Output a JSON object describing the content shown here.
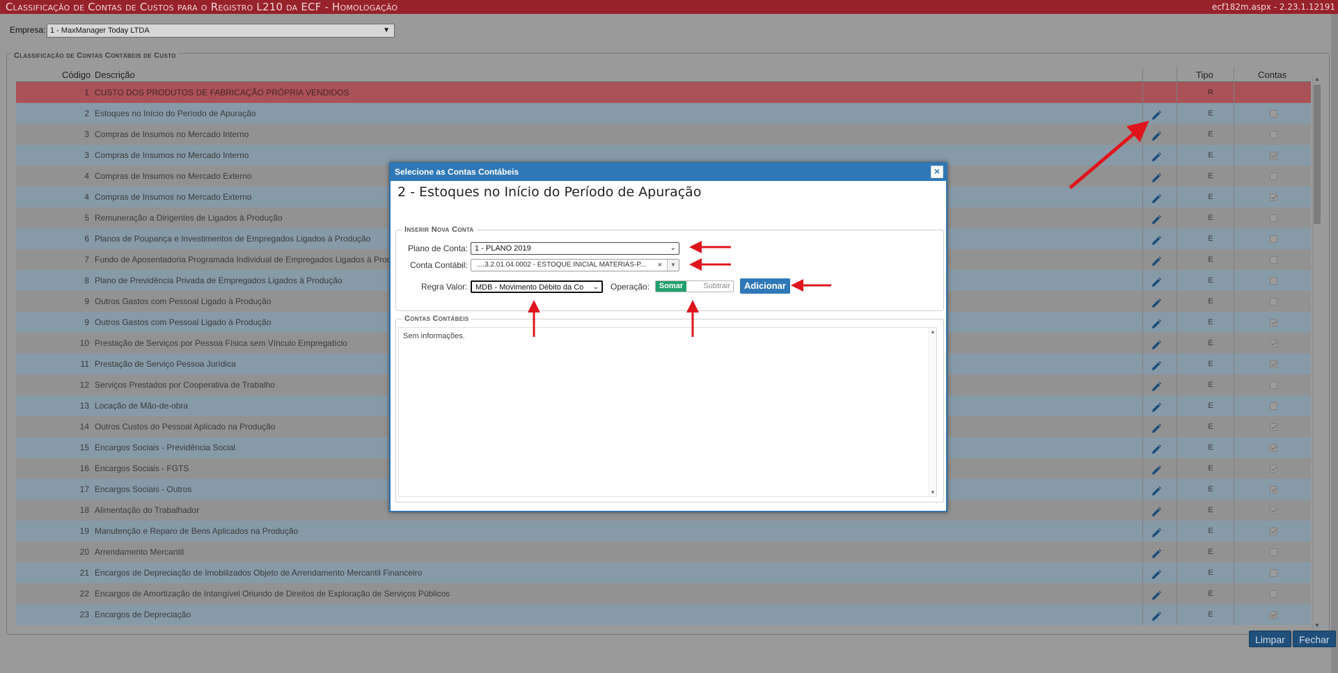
{
  "window": {
    "title": "Classificação de Contas de Custos para o Registro L210 da ECF  - Homologação",
    "version": "ecf182m.aspx - 2.23.1.12191"
  },
  "empresa": {
    "label": "Empresa:",
    "value": "1 - MaxManager Today LTDA"
  },
  "section_legend": "Classificação de Contas Contábeis de Custo",
  "table": {
    "headers": {
      "codigo": "Código",
      "descricao": "Descrição",
      "tipo": "Tipo",
      "contas": "Contas"
    },
    "rows": [
      {
        "codigo": "1",
        "descricao": "CUSTO DOS PRODUTOS DE FABRICAÇÃO PRÓPRIA VENDIDOS",
        "tipo": "R",
        "edit": false,
        "checked": false,
        "check": false
      },
      {
        "codigo": "2",
        "descricao": "Estoques no Início do Período de Apuração",
        "tipo": "E",
        "edit": true,
        "checked": false,
        "check": true
      },
      {
        "codigo": "3",
        "descricao": "Compras de Insumos no Mercado Interno",
        "tipo": "E",
        "edit": true,
        "checked": false,
        "check": true
      },
      {
        "codigo": "3",
        "descricao": "Compras de Insumos no Mercado Interno",
        "tipo": "E",
        "edit": true,
        "checked": true,
        "check": true
      },
      {
        "codigo": "4",
        "descricao": "Compras de Insumos no Mercado Externo",
        "tipo": "E",
        "edit": true,
        "checked": false,
        "check": true
      },
      {
        "codigo": "4",
        "descricao": "Compras de Insumos no Mercado Externo",
        "tipo": "E",
        "edit": true,
        "checked": true,
        "check": true
      },
      {
        "codigo": "5",
        "descricao": "Remuneração a Dirigentes de Ligados à Produção",
        "tipo": "E",
        "edit": true,
        "checked": false,
        "check": true
      },
      {
        "codigo": "6",
        "descricao": "Planos de Poupança e Investimentos de Empregados Ligados à Produção",
        "tipo": "E",
        "edit": true,
        "checked": false,
        "check": true
      },
      {
        "codigo": "7",
        "descricao": "Fundo de Aposentadoria Programada Individual de Empregados Ligados à Prod",
        "tipo": "E",
        "edit": true,
        "checked": false,
        "check": true
      },
      {
        "codigo": "8",
        "descricao": "Plano de Previdência Privada de Empregados Ligados à Produção",
        "tipo": "E",
        "edit": true,
        "checked": false,
        "check": true
      },
      {
        "codigo": "9",
        "descricao": "Outros Gastos com Pessoal Ligado à Produção",
        "tipo": "E",
        "edit": true,
        "checked": false,
        "check": true
      },
      {
        "codigo": "9",
        "descricao": "Outros Gastos com Pessoal Ligado à Produção",
        "tipo": "E",
        "edit": true,
        "checked": true,
        "check": true
      },
      {
        "codigo": "10",
        "descricao": "Prestação de Serviços por Pessoa Física sem Vínculo Empregatício",
        "tipo": "E",
        "edit": true,
        "checked": true,
        "check": true
      },
      {
        "codigo": "11",
        "descricao": "Prestação de Serviço Pessoa Jurídica",
        "tipo": "E",
        "edit": true,
        "checked": true,
        "check": true
      },
      {
        "codigo": "12",
        "descricao": "Serviços Prestados por Cooperativa de Trabalho",
        "tipo": "E",
        "edit": true,
        "checked": false,
        "check": true
      },
      {
        "codigo": "13",
        "descricao": "Locação de Mão-de-obra",
        "tipo": "E",
        "edit": true,
        "checked": false,
        "check": true
      },
      {
        "codigo": "14",
        "descricao": "Outros Custos do Pessoal Aplicado na Produção",
        "tipo": "E",
        "edit": true,
        "checked": true,
        "check": true
      },
      {
        "codigo": "15",
        "descricao": "Encargos Sociais - Previdência Social",
        "tipo": "E",
        "edit": true,
        "checked": true,
        "check": true
      },
      {
        "codigo": "16",
        "descricao": "Encargos Sociais - FGTS",
        "tipo": "E",
        "edit": true,
        "checked": true,
        "check": true
      },
      {
        "codigo": "17",
        "descricao": "Encargos Sociais - Outros",
        "tipo": "E",
        "edit": true,
        "checked": true,
        "check": true
      },
      {
        "codigo": "18",
        "descricao": "Alimentação do Trabalhador",
        "tipo": "E",
        "edit": true,
        "checked": true,
        "check": true
      },
      {
        "codigo": "19",
        "descricao": "Manutenção e Reparo de Bens Aplicados na Produção",
        "tipo": "E",
        "edit": true,
        "checked": true,
        "check": true
      },
      {
        "codigo": "20",
        "descricao": "Arrendamento Mercantil",
        "tipo": "E",
        "edit": true,
        "checked": false,
        "check": true
      },
      {
        "codigo": "21",
        "descricao": "Encargos de Depreciação de Imobilizados Objeto de Arrendamento Mercantil Financeiro",
        "tipo": "E",
        "edit": true,
        "checked": false,
        "check": true
      },
      {
        "codigo": "22",
        "descricao": "Encargos de Amortização de Intangível Oriundo de Direitos de Exploração de Serviços Públicos",
        "tipo": "E",
        "edit": true,
        "checked": false,
        "check": true
      },
      {
        "codigo": "23",
        "descricao": "Encargos de Depreciação",
        "tipo": "E",
        "edit": true,
        "checked": true,
        "check": true
      }
    ]
  },
  "buttons": {
    "limpar": "Limpar",
    "fechar": "Fechar"
  },
  "modal": {
    "header": "Selecione as Contas Contábeis",
    "close": "×",
    "title": "2 - Estoques no Início do Período de Apuração",
    "inserir_legend": "Inserir Nova Conta",
    "plano_label": "Plano de Conta:",
    "plano_value": "1 - PLANO 2019",
    "conta_label": "Conta Contábil:",
    "conta_value": "....3.2.01.04.0002 - ESTOQUE INICIAL MATERIAS-P...",
    "conta_clear": "×",
    "regra_label": "Regra Valor:",
    "regra_value": "MDB - Movimento Débito da Co",
    "operacao_label": "Operação:",
    "operacao_on": "Somar",
    "operacao_off": "Subtrair",
    "adicionar": "Adicionar",
    "contas_legend": "Contas Contábeis",
    "empty_message": "Sem informações."
  },
  "colors": {
    "titlebar": "#97222b",
    "highlight_row": "#a95258",
    "row_blue": "#879aa8",
    "row_gray": "#929292",
    "modal_header": "#2f78b7",
    "toggle_on": "#22a06b",
    "arrow": "#e0141c"
  },
  "icons": [
    "pencil-icon",
    "close-icon",
    "chevron-down-icon",
    "checkbox-icon",
    "arrow-annotation"
  ]
}
